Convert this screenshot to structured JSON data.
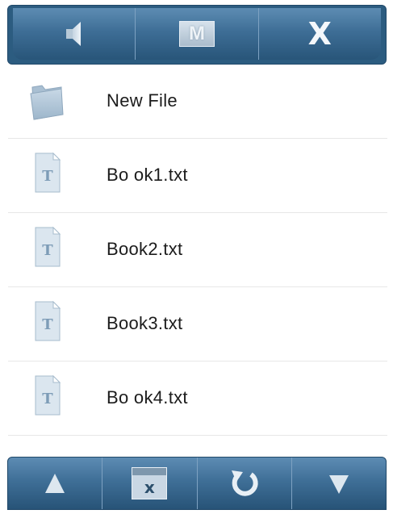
{
  "top_toolbar": {
    "buttons": [
      {
        "icon": "speaker-icon"
      },
      {
        "icon": "menu-icon",
        "glyph": "M"
      },
      {
        "icon": "close-icon",
        "glyph": "X"
      }
    ]
  },
  "file_list": {
    "items": [
      {
        "type": "folder",
        "icon": "folder-icon",
        "label": "New File"
      },
      {
        "type": "text-file",
        "icon": "text-file-icon",
        "label": "Bo ok1.txt"
      },
      {
        "type": "text-file",
        "icon": "text-file-icon",
        "label": "Book2.txt"
      },
      {
        "type": "text-file",
        "icon": "text-file-icon",
        "label": "Book3.txt"
      },
      {
        "type": "text-file",
        "icon": "text-file-icon",
        "label": "Bo ok4.txt"
      }
    ]
  },
  "bottom_toolbar": {
    "buttons": [
      {
        "icon": "arrow-up-icon"
      },
      {
        "icon": "close-window-icon",
        "glyph": "x"
      },
      {
        "icon": "refresh-icon"
      },
      {
        "icon": "arrow-down-icon"
      }
    ]
  },
  "colors": {
    "toolbar_dark": "#2c5c80",
    "toolbar_light": "#5d8cb3",
    "icon_light": "#dde7ef"
  }
}
